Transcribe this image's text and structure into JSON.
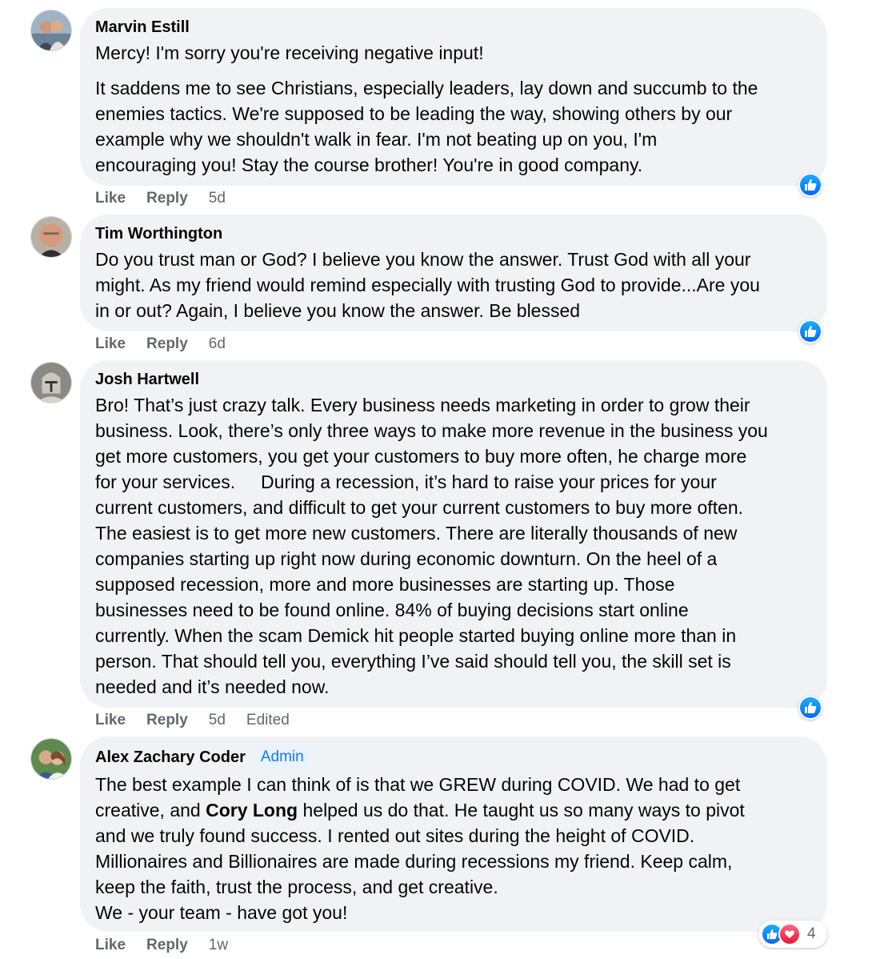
{
  "comments": [
    {
      "author": "Marvin Estill",
      "paragraphs": [
        "Mercy! I'm sorry you're receiving negative input!",
        "It saddens me to see Christians, especially leaders, lay down and succumb to the\nenemies tactics. We're supposed to be leading the way, showing others by our\nexample why we shouldn't walk in fear. I'm not beating up on you, I'm\nencouraging you! Stay the course brother! You're in good company."
      ],
      "actions": {
        "like": "Like",
        "reply": "Reply",
        "time": "5d"
      }
    },
    {
      "author": "Tim Worthington",
      "paragraphs": [
        "Do you trust man or God? I believe you know the answer. Trust God with all your\nmight. As my friend would remind especially with trusting God to provide...Are you\nin or out? Again, I believe you know the answer. Be blessed"
      ],
      "actions": {
        "like": "Like",
        "reply": "Reply",
        "time": "6d"
      }
    },
    {
      "author": "Josh Hartwell",
      "paragraphs": [
        "Bro! That’s just crazy talk. Every business needs marketing in order to grow their\nbusiness. Look, there’s only three ways to make more revenue in the business you\nget more customers, you get your customers to buy more often, he charge more\nfor your services.     During a recession, it’s hard to raise your prices for your\ncurrent customers, and difficult to get your current customers to buy more often.\nThe easiest is to get more new customers. There are literally thousands of new\ncompanies starting up right now during economic downturn. On the heel of a\nsupposed recession, more and more businesses are starting up. Those\nbusinesses need to be found online. 84% of buying decisions start online\ncurrently. When the scam Demick hit people started buying online more than in\nperson. That should tell you, everything I’ve said should tell you, the skill set is\nneeded and it’s needed now."
      ],
      "actions": {
        "like": "Like",
        "reply": "Reply",
        "time": "5d",
        "edited": "Edited"
      }
    },
    {
      "author": "Alex Zachary Coder",
      "badge": "Admin",
      "text_before_mention": "The best example I can think of is that we GREW during COVID. We had to get\ncreative, and ",
      "mention": "Cory Long",
      "text_after_mention": " helped us do that. He taught us so many ways to pivot\nand we truly found success. I rented out sites during the height of COVID.\nMillionaires and Billionaires are made during recessions my friend. Keep calm,\nkeep the faith, trust the process, and get creative.\nWe - your team - have got you!",
      "actions": {
        "like": "Like",
        "reply": "Reply",
        "time": "1w"
      },
      "reactions": {
        "count": "4",
        "types": [
          "like-icon",
          "love-icon"
        ]
      }
    }
  ],
  "colors": {
    "bubble": "#f0f2f5",
    "meta_text": "#65676b",
    "like_blue": "#0866ff",
    "love_red": "#e61739",
    "admin_badge_bg": "#e7f3ff",
    "admin_badge_text": "#1877f2"
  }
}
